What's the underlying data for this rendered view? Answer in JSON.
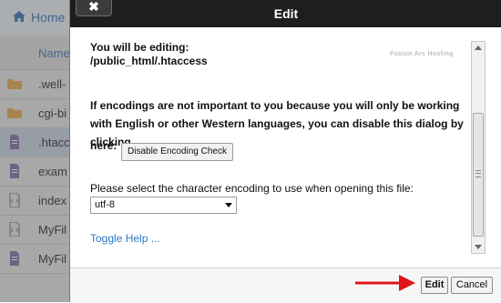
{
  "background": {
    "home_label": "Home",
    "column_header": "Name",
    "files": [
      {
        "name": ".well-",
        "icon": "folder-icon"
      },
      {
        "name": "cgi-bi",
        "icon": "folder-icon"
      },
      {
        "name": ".htacc",
        "icon": "document-icon",
        "selected": true
      },
      {
        "name": "exam",
        "icon": "document-icon"
      },
      {
        "name": "index",
        "icon": "code-file-icon"
      },
      {
        "name": "MyFil",
        "icon": "code-file-icon"
      },
      {
        "name": "MyFil",
        "icon": "document-icon"
      }
    ]
  },
  "dialog": {
    "title": "Edit",
    "close_label": "✖",
    "editing_line1": "You will be editing:",
    "editing_line2": "/public_html/.htaccess",
    "watermark": "Fusion Arc Hosting",
    "info_text": "If encodings are not important to you because you will only be working with English or other Western languages, you can disable this dialog by clicking",
    "here_text": "here:",
    "disable_button": "Disable Encoding Check",
    "encoding_prompt": "Please select the character encoding to use when opening this file:",
    "encoding_value": "utf-8",
    "toggle_help": "Toggle Help ...",
    "edit_button": "Edit",
    "cancel_button": "Cancel"
  },
  "colors": {
    "titlebar": "#1e1e1e",
    "link": "#2f78c8",
    "arrow": "#e0141b",
    "folder": "#e8b86b",
    "document": "#9a8ab8"
  }
}
